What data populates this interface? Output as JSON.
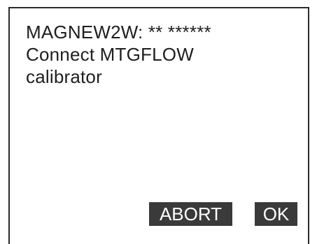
{
  "display": {
    "header": "MAGNEW2W: ** ******",
    "message_line1": "Connect MTGFLOW",
    "message_line2": "calibrator"
  },
  "softkeys": {
    "abort_label": "ABORT",
    "ok_label": "OK"
  },
  "colors": {
    "frame": "#2b2b2b",
    "text": "#1e1e1e",
    "softkey_bg": "#3a3a3a",
    "softkey_text": "#ffffff"
  }
}
